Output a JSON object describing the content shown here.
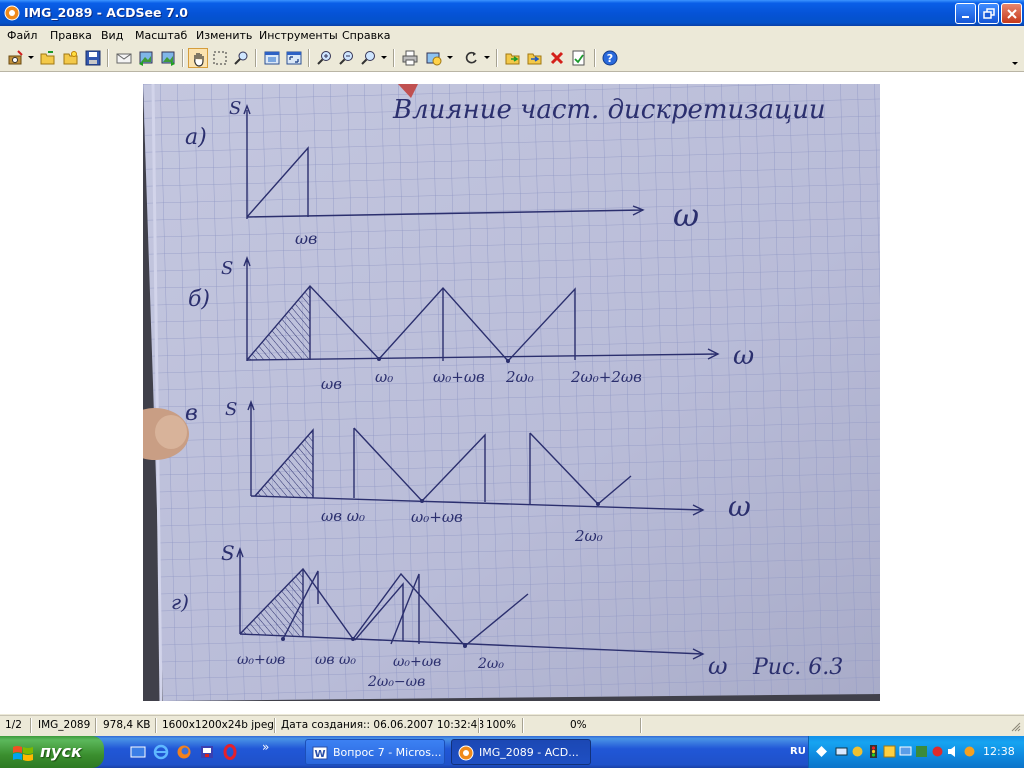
{
  "window": {
    "title": "IMG_2089 - ACDSee 7.0"
  },
  "menu": {
    "items": [
      "Файл",
      "Правка",
      "Вид",
      "Масштаб",
      "Изменить",
      "Инструменты",
      "Справка"
    ]
  },
  "toolbar": {
    "icons": [
      "acquire-icon",
      "open-folder-icon",
      "browse-icon",
      "save-icon",
      "email-icon",
      "prev-image-icon",
      "next-image-icon",
      "hand-tool-icon",
      "select-tool-icon",
      "magnify-icon",
      "fit-window-icon",
      "full-screen-icon",
      "zoom-in-icon",
      "zoom-out-icon",
      "zoom-menu-icon",
      "print-icon",
      "slideshow-icon",
      "rotate-icon",
      "copy-to-icon",
      "move-to-icon",
      "delete-icon",
      "properties-icon",
      "help-icon"
    ]
  },
  "status": {
    "index": "1/2",
    "filename": "IMG_2089",
    "filesize": "978,4 KB",
    "dimensions": "1600x1200x24b jpeg",
    "created": "Дата создания:: 06.06.2007 10:32:48",
    "zoom": "100%",
    "progress": "0%"
  },
  "taskbar": {
    "start_label": "пуск",
    "tasks": [
      {
        "label": "Вопрос 7 - Micros..."
      },
      {
        "label": "IMG_2089 - ACD..."
      }
    ],
    "language": "RU",
    "clock": "12:38",
    "more_quicklaunch": "»"
  },
  "photo": {
    "heading": "Влияние част. дискретизации",
    "labels": {
      "a": "а)",
      "b": "б)",
      "v": "в",
      "g": "г)",
      "s": "S",
      "omega": "ω",
      "a_wb": "ωв",
      "b_wb": "ωв",
      "b_w0": "ω₀",
      "b_w0wb": "ω₀+ωв",
      "b_2w0": "2ω₀",
      "b_2w0wb": "2ω₀+2ωв",
      "v_wbw0": "ωв ω₀",
      "v_w0wb": "ω₀+ωв",
      "v_2w0": "2ω₀",
      "g_w0wb": "ω₀+ωв",
      "g_wbw0": "ωв ω₀",
      "g_w0wb2": "ω₀+ωв",
      "g_2w0": "2ω₀",
      "g_2w0wb": "2ω₀−ωв",
      "fig": "Рис. 6.3"
    }
  }
}
